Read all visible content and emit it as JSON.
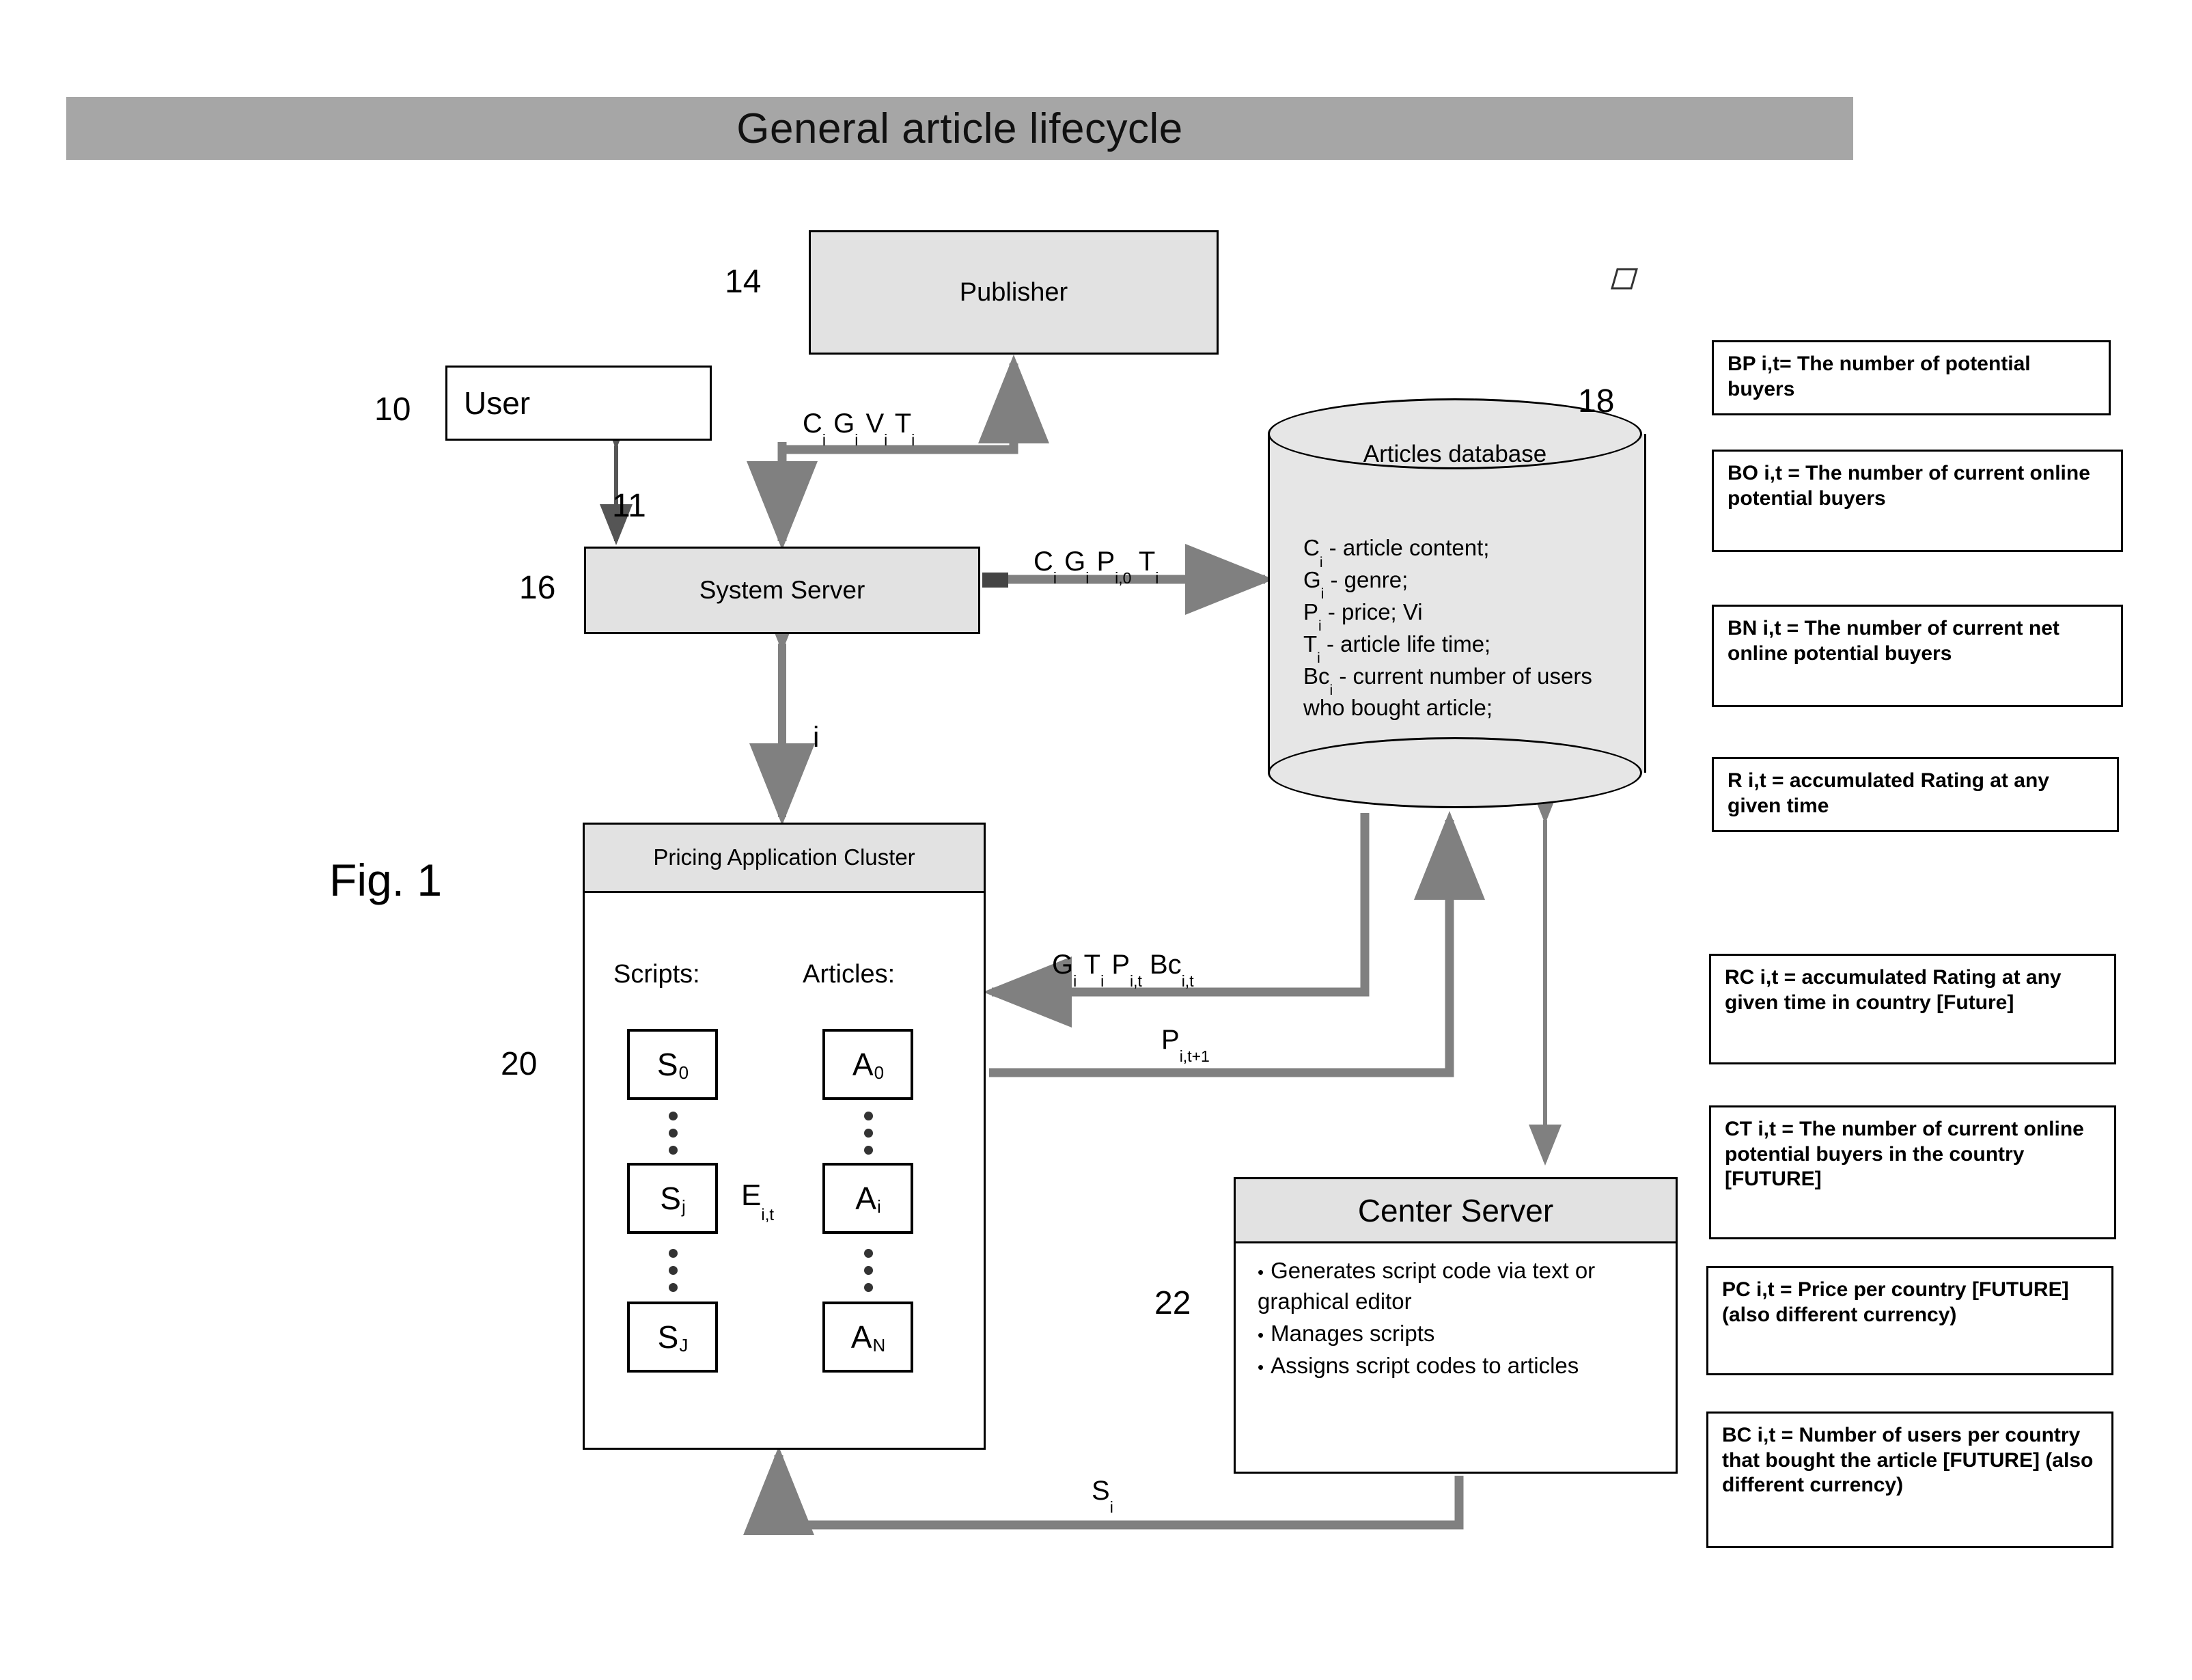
{
  "header": {
    "title": "General article lifecycle"
  },
  "figure": {
    "label": "Fig. 1"
  },
  "nodes": {
    "publisher": {
      "label": "Publisher",
      "ref": "14"
    },
    "user": {
      "label": "User",
      "ref": "10"
    },
    "system_server": {
      "label": "System Server",
      "ref": "16"
    },
    "user_server_ref": "11",
    "pricing_cluster": {
      "title": "Pricing Application Cluster",
      "ref": "20",
      "scripts_label": "Scripts:",
      "articles_label": "Articles:",
      "scripts": [
        "S",
        "S",
        "S"
      ],
      "script_subs": [
        "0",
        "j",
        "J"
      ],
      "articles": [
        "A",
        "A",
        "A"
      ],
      "article_subs": [
        "0",
        "i",
        "N"
      ],
      "exchange_label": "E",
      "exchange_sub": "i,t"
    },
    "database": {
      "ref": "18",
      "title": "Articles database",
      "fields": [
        {
          "sym": "C",
          "sub": "i",
          "text": " - article content;"
        },
        {
          "sym": "G",
          "sub": "i",
          "text": " - genre;"
        },
        {
          "sym": "P",
          "sub": "i",
          "text": " - price;  Vi"
        },
        {
          "sym": "T",
          "sub": "i",
          "text": " - article life time;"
        },
        {
          "sym": "Bc",
          "sub": "i",
          "text": " - current number of users who bought article;"
        }
      ]
    },
    "center_server": {
      "ref": "22",
      "title": "Center Server",
      "bullets": [
        "Generates script code via text or graphical editor",
        "Manages scripts",
        "Assigns script codes to articles"
      ]
    }
  },
  "edges": {
    "user_to_publisher": "C i G i V i T i",
    "server_to_db": "C i G i P i,0 T i",
    "db_to_cluster": "G i T i P i,t Bc i,t",
    "cluster_to_db": "P i,t+1",
    "center_to_cluster": "S i",
    "server_cluster": "i"
  },
  "legend": [
    {
      "id": "BP",
      "text": "BP i,t= The number of potential buyers"
    },
    {
      "id": "BO",
      "text": "BO i,t = The number of current online potential buyers"
    },
    {
      "id": "BN",
      "text": "BN i,t = The number of current net online potential buyers"
    },
    {
      "id": "R",
      "text": "R i,t = accumulated Rating at any given time"
    },
    {
      "id": "RC",
      "text": "RC  i,t = accumulated Rating at any given time in country [Future]"
    },
    {
      "id": "CT",
      "text": "CT i,t = The number of current online potential buyers in the country [FUTURE]"
    },
    {
      "id": "PC",
      "text": "PC i,t = Price per country [FUTURE]  (also different currency)"
    },
    {
      "id": "BC",
      "text": "BC i,t = Number of users per country that bought the article [FUTURE]  (also different currency)"
    }
  ],
  "colors": {
    "header_bar": "#a6a6a6",
    "box_fill": "#e2e2e2",
    "db_fill": "#e6e6e6",
    "connector": "#808080",
    "stroke": "#000000"
  }
}
